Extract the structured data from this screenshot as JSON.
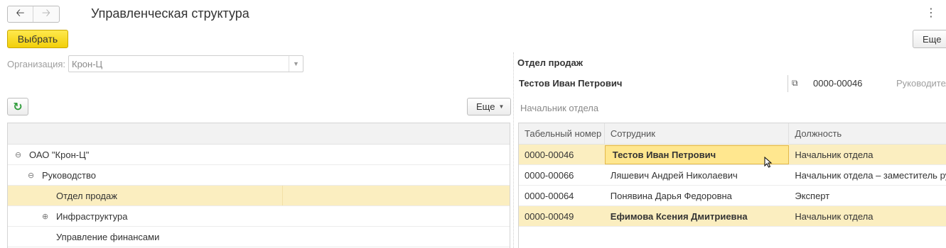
{
  "window": {
    "title": "Управленческая структура",
    "back_icon": "arrow-left-icon",
    "forward_icon": "arrow-right-icon",
    "menu_icon": "kebab-menu-icon"
  },
  "toolbar": {
    "select_label": "Выбрать",
    "more_label": "Еще"
  },
  "organization": {
    "label": "Организация:",
    "value": "Крон-Ц"
  },
  "tree_panel": {
    "refresh_icon": "refresh-icon",
    "more_label": "Еще",
    "nodes": [
      {
        "label": "ОАО \"Крон-Ц\"",
        "level": 0,
        "expander": "⊖",
        "selected": false
      },
      {
        "label": "Руководство",
        "level": 1,
        "expander": "⊖",
        "selected": false
      },
      {
        "label": "Отдел продаж",
        "level": 2,
        "expander": "",
        "selected": true
      },
      {
        "label": "Инфраструктура",
        "level": 2,
        "expander": "⊕",
        "selected": false
      },
      {
        "label": "Управление финансами",
        "level": 2,
        "expander": "",
        "selected": false
      }
    ]
  },
  "department": {
    "title": "Отдел продаж",
    "head_name": "Тестов Иван Петрович",
    "head_code": "0000-00046",
    "head_role": "Руководитель",
    "position": "Начальник отдела"
  },
  "employees": {
    "columns": [
      "Табельный номер",
      "Сотрудник",
      "Должность"
    ],
    "rows": [
      {
        "number": "0000-00046",
        "name": "Тестов Иван Петрович",
        "position": "Начальник отдела"
      },
      {
        "number": "0000-00066",
        "name": "Ляшевич Андрей Николаевич",
        "position": "Начальник отдела – заместитель руководителя"
      },
      {
        "number": "0000-00064",
        "name": "Понявина Дарья Федоровна",
        "position": "Эксперт"
      },
      {
        "number": "0000-00049",
        "name": "Ефимова Ксения Дмитриевна",
        "position": "Начальник отдела"
      }
    ]
  },
  "colors": {
    "accent_button": "#f2cf09",
    "selected_row": "#fbeec0",
    "refresh": "#2f9c3b"
  }
}
